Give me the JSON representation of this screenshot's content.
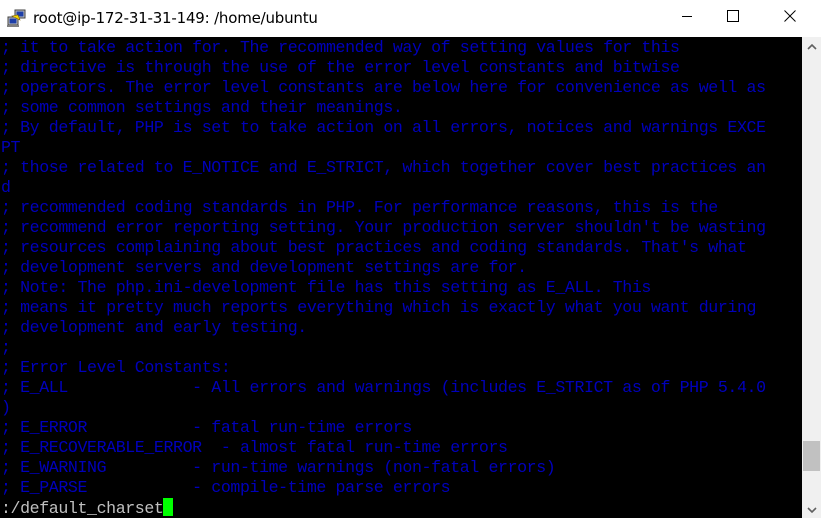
{
  "window": {
    "title": "root@ip-172-31-31-149: /home/ubuntu",
    "app_icon": "putty-icon",
    "controls": {
      "minimize": "minimize-icon",
      "maximize": "maximize-icon",
      "close": "close-icon"
    }
  },
  "terminal": {
    "colors": {
      "background": "#000000",
      "comment_text": "#0000bb",
      "command_text": "#c0c0c0",
      "cursor": "#00ff00"
    },
    "lines": [
      "; it to take action for. The recommended way of setting values for this",
      "; directive is through the use of the error level constants and bitwise",
      "; operators. The error level constants are below here for convenience as well as",
      "; some common settings and their meanings.",
      "; By default, PHP is set to take action on all errors, notices and warnings EXCE",
      "PT",
      "; those related to E_NOTICE and E_STRICT, which together cover best practices an",
      "d",
      "; recommended coding standards in PHP. For performance reasons, this is the",
      "; recommend error reporting setting. Your production server shouldn't be wasting",
      "; resources complaining about best practices and coding standards. That's what",
      "; development servers and development settings are for.",
      "; Note: The php.ini-development file has this setting as E_ALL. This",
      "; means it pretty much reports everything which is exactly what you want during",
      "; development and early testing.",
      ";",
      "; Error Level Constants:",
      "; E_ALL             - All errors and warnings (includes E_STRICT as of PHP 5.4.0",
      ")",
      "; E_ERROR           - fatal run-time errors",
      "; E_RECOVERABLE_ERROR  - almost fatal run-time errors",
      "; E_WARNING         - run-time warnings (non-fatal errors)",
      "; E_PARSE           - compile-time parse errors"
    ],
    "command_line": ":/default_charset"
  },
  "scrollbar": {
    "position_fraction": 0.93,
    "up_icon": "chevron-up-icon",
    "down_icon": "chevron-down-icon"
  }
}
